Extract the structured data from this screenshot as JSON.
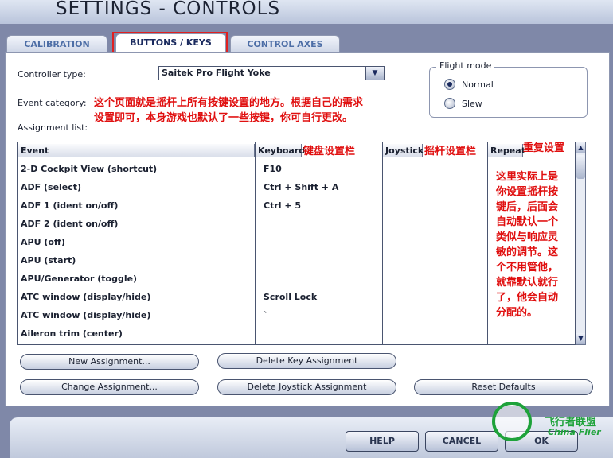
{
  "window": {
    "title": "SETTINGS - CONTROLS"
  },
  "tabs": [
    {
      "label": "CALIBRATION",
      "active": false
    },
    {
      "label": "BUTTONS / KEYS",
      "active": true
    },
    {
      "label": "CONTROL AXES",
      "active": false
    }
  ],
  "controller": {
    "label": "Controller type:",
    "value": "Saitek Pro Flight Yoke"
  },
  "event_category": {
    "label": "Event category:"
  },
  "assignment_list": {
    "label": "Assignment list:"
  },
  "flight_mode": {
    "title": "Flight mode",
    "options": [
      {
        "label": "Normal",
        "selected": true
      },
      {
        "label": "Slew",
        "selected": false
      }
    ]
  },
  "annotations": {
    "main_line1": "这个页面就是摇杆上所有按键设置的地方。根据自己的需求",
    "main_line2": "设置即可，本身游戏也默认了一些按键，你可自行更改。",
    "keyboard_note": "键盘设置栏",
    "joystick_note": "摇杆设置栏",
    "repeat_note": "重复设置",
    "repeat_detail": [
      "这里实际上是",
      "你设置摇杆按",
      "键后，后面会",
      "自动默认一个",
      "类似与响应灵",
      "敏的调节。这",
      "个不用管他，",
      "就靠默认就行",
      "了，他会自动",
      "分配的。"
    ]
  },
  "table": {
    "columns": [
      "Event",
      "Keyboard",
      "Joystick",
      "Repeat"
    ],
    "rows": [
      {
        "event": "2-D Cockpit View (shortcut)",
        "keyboard": "F10",
        "joystick": ""
      },
      {
        "event": "ADF (select)",
        "keyboard": "Ctrl + Shift + A",
        "joystick": ""
      },
      {
        "event": "ADF 1 (ident on/off)",
        "keyboard": "Ctrl + 5",
        "joystick": ""
      },
      {
        "event": "ADF 2 (ident on/off)",
        "keyboard": "",
        "joystick": ""
      },
      {
        "event": "APU (off)",
        "keyboard": "",
        "joystick": ""
      },
      {
        "event": "APU (start)",
        "keyboard": "",
        "joystick": ""
      },
      {
        "event": "APU/Generator (toggle)",
        "keyboard": "",
        "joystick": ""
      },
      {
        "event": "ATC window (display/hide)",
        "keyboard": "Scroll Lock",
        "joystick": ""
      },
      {
        "event": "ATC window (display/hide)",
        "keyboard": "`",
        "joystick": ""
      },
      {
        "event": "Aileron trim (center)",
        "keyboard": "",
        "joystick": ""
      }
    ]
  },
  "buttons": {
    "new_assignment": "New Assignment...",
    "delete_key": "Delete Key Assignment",
    "change_assignment": "Change Assignment...",
    "delete_joystick": "Delete Joystick Assignment",
    "reset_defaults": "Reset Defaults",
    "help": "HELP",
    "cancel": "CANCEL",
    "ok": "OK"
  },
  "watermark": {
    "name": "飞行者联盟",
    "sub": "China Flier"
  },
  "colors": {
    "annotation": "#e01010",
    "accent": "#1a2a5e",
    "watermark": "#1ea23a"
  }
}
